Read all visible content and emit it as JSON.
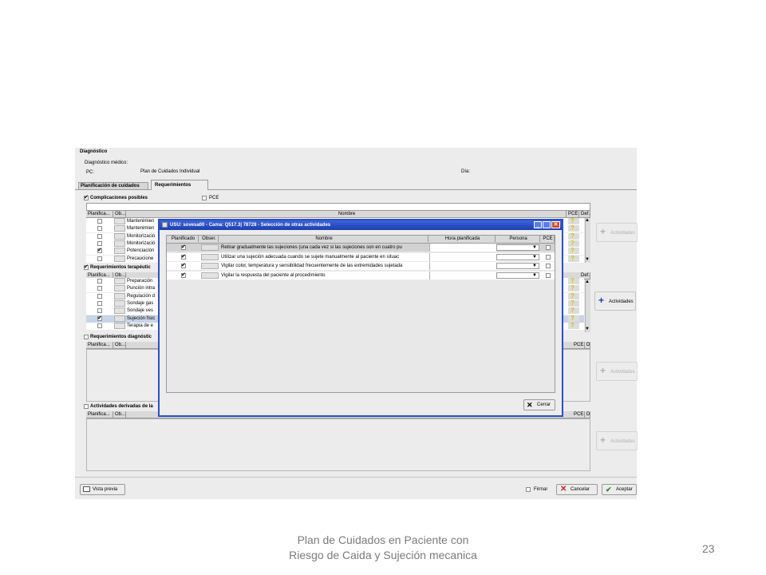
{
  "app": {
    "section_title": "Diagnóstico",
    "diag_label": "Diagnóstico médico:",
    "pc_label": "PC:",
    "pc_value": "Plan de Cuidados Individual",
    "dia_label": "Día:"
  },
  "tabs": [
    {
      "label": "Planificación de cuidados"
    },
    {
      "label": "Requerimientos"
    }
  ],
  "sections": {
    "complicaciones": {
      "label": "Complicaciones posibles",
      "pce_label": "PCE",
      "checked": true
    },
    "terapeuticos": {
      "label": "Requerimientos terapéutic",
      "checked": true
    },
    "diagnosticos": {
      "label": "Requerimientos diagnóstic",
      "checked": false
    },
    "derivadas": {
      "label": "Actividades derivadas de la",
      "checked": false
    }
  },
  "table_headers": {
    "planifica": "Planifica...",
    "ob": "Ob...",
    "nombre": "Nombre",
    "pce": "PCE",
    "def": "Def."
  },
  "complicaciones_rows": [
    {
      "name": "Mantenimien",
      "checked": false
    },
    {
      "name": "Mantenimien",
      "checked": false
    },
    {
      "name": "Monitorizació",
      "checked": false
    },
    {
      "name": "Monitorizació",
      "checked": false
    },
    {
      "name": "Potenciación",
      "checked": true
    },
    {
      "name": "Precaucione",
      "checked": false
    }
  ],
  "terapeuticos_rows": [
    {
      "name": "Preparación",
      "checked": false
    },
    {
      "name": "Punción intra",
      "checked": false
    },
    {
      "name": "Regulación d",
      "checked": false
    },
    {
      "name": "Sondaje gas",
      "checked": false
    },
    {
      "name": "Sondaje ves",
      "checked": false
    },
    {
      "name": "Sujeción físic",
      "checked": true,
      "selected": true
    },
    {
      "name": "Terapia de e",
      "checked": false
    }
  ],
  "side_buttons": {
    "actividades": "Actividades"
  },
  "dialog": {
    "title": "USU: sovesa00 - Cama: Q517.3| 78728 - Selección de otras actividades",
    "headers": {
      "planificado": "Planificado",
      "obser": "Obser.",
      "nombre": "Nombre",
      "hora": "Hora planificada",
      "persona": "Persona",
      "pce": "PCE"
    },
    "rows": [
      {
        "checked": true,
        "name": "Retirar gradualmente las sujeciones (una cada vez si las sujeciones son en cuatro pu"
      },
      {
        "checked": true,
        "name": "Utilizar una sujeción  adecuada cuando se sujete manualmente al paciente en situac"
      },
      {
        "checked": true,
        "name": "Vigilar color, temperatura y sensibilidad frecuentemente de las extremidades sujetada"
      },
      {
        "checked": true,
        "name": "Vigilar la respuesta del paciente al procedimiento"
      }
    ],
    "close_label": "Cerrar"
  },
  "footer": {
    "preview_label": "Vista previa",
    "firmar_label": "Firmar",
    "cancel_label": "Cancelar",
    "accept_label": "Aceptar"
  },
  "slide": {
    "caption_line1": "Plan de Cuidados en Paciente con",
    "caption_line2": "Riesgo de Caida y Sujeción mecanica",
    "page_number": "23"
  },
  "colors": {
    "window_bg": "#ececec",
    "dialog_title_bg": "#1c3fb0",
    "dialog_border": "#2a4fc8",
    "close_btn": "#d04a2a",
    "accent_blue": "#1a44b8"
  }
}
